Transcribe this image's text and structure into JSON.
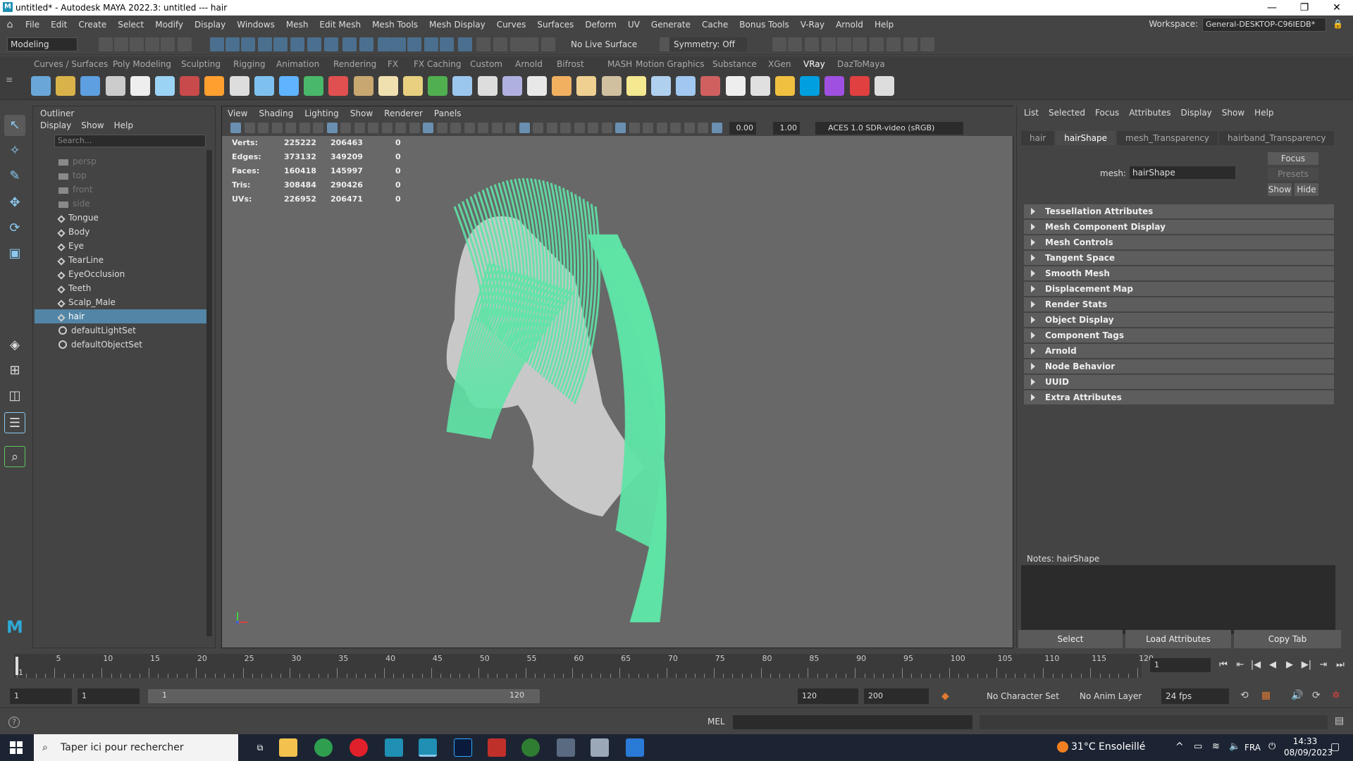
{
  "window": {
    "title": "untitled* - Autodesk MAYA 2022.3: untitled   ---   hair",
    "minimize": "—",
    "restore": "❐",
    "close": "✕"
  },
  "menubar": {
    "items": [
      "File",
      "Edit",
      "Create",
      "Select",
      "Modify",
      "Display",
      "Windows",
      "Mesh",
      "Edit Mesh",
      "Mesh Tools",
      "Mesh Display",
      "Curves",
      "Surfaces",
      "Deform",
      "UV",
      "Generate",
      "Cache",
      "Bonus Tools",
      "V-Ray",
      "Arnold",
      "Help"
    ],
    "workspace_label": "Workspace:",
    "workspace_value": "General-DESKTOP-C96IEDB*"
  },
  "statusline": {
    "mode": "Modeling",
    "live_surface": "No Live Surface",
    "symmetry": "Symmetry: Off"
  },
  "shelf": {
    "tabs": [
      "Curves / Surfaces",
      "Poly Modeling",
      "Sculpting",
      "Rigging",
      "Animation",
      "Rendering",
      "FX",
      "FX Caching",
      "Custom",
      "Arnold",
      "Bifrost",
      "MASH",
      "Motion Graphics",
      "Substance",
      "XGen",
      "VRay",
      "DazToMaya"
    ],
    "active_tab": "VRay",
    "icon_colors": [
      "#6aa7d8",
      "#d9b24a",
      "#5d9fe0",
      "#ccc",
      "#eee",
      "#9bd3f5",
      "#c84a4a",
      "#ff9f30",
      "#ddd",
      "#7ec1f0",
      "#5fb3ff",
      "#4ab86a",
      "#e05050",
      "#c8a870",
      "#f0e0b0",
      "#e8d080",
      "#50b050",
      "#9bc7ef",
      "#ddd",
      "#b0b0e0",
      "#e8e8e8",
      "#f0b060",
      "#f0d090",
      "#d0c0a0",
      "#f4e890",
      "#b0d0f0",
      "#a0c8f0",
      "#d06060",
      "#eee",
      "#e0e0e0",
      "#f0c040",
      "#00a0e0",
      "#a050e0",
      "#e04040",
      "#ddd"
    ]
  },
  "outliner": {
    "title": "Outliner",
    "menu": [
      "Display",
      "Show",
      "Help"
    ],
    "search_placeholder": "Search...",
    "items": [
      {
        "label": "persp",
        "kind": "camera"
      },
      {
        "label": "top",
        "kind": "camera"
      },
      {
        "label": "front",
        "kind": "camera"
      },
      {
        "label": "side",
        "kind": "camera"
      },
      {
        "label": "Tongue",
        "kind": "mesh"
      },
      {
        "label": "Body",
        "kind": "mesh"
      },
      {
        "label": "Eye",
        "kind": "mesh"
      },
      {
        "label": "TearLine",
        "kind": "mesh"
      },
      {
        "label": "EyeOcclusion",
        "kind": "mesh"
      },
      {
        "label": "Teeth",
        "kind": "mesh"
      },
      {
        "label": "Scalp_Male",
        "kind": "mesh"
      },
      {
        "label": "hair",
        "kind": "mesh",
        "selected": true
      },
      {
        "label": "defaultLightSet",
        "kind": "set"
      },
      {
        "label": "defaultObjectSet",
        "kind": "set"
      }
    ]
  },
  "viewport": {
    "menu": [
      "View",
      "Shading",
      "Lighting",
      "Show",
      "Renderer",
      "Panels"
    ],
    "exposure": "0.00",
    "gamma": "1.00",
    "colorspace": "ACES 1.0 SDR-video (sRGB)",
    "hud": [
      {
        "label": "Verts:",
        "a": "225222",
        "b": "206463",
        "c": "0"
      },
      {
        "label": "Edges:",
        "a": "373132",
        "b": "349209",
        "c": "0"
      },
      {
        "label": "Faces:",
        "a": "160418",
        "b": "145997",
        "c": "0"
      },
      {
        "label": "Tris:",
        "a": "308484",
        "b": "290426",
        "c": "0"
      },
      {
        "label": "UVs:",
        "a": "226952",
        "b": "206471",
        "c": "0"
      }
    ],
    "hair_color": "#5fe3a6",
    "skin_color": "#c8c8c8"
  },
  "attribute_editor": {
    "menu": [
      "List",
      "Selected",
      "Focus",
      "Attributes",
      "Display",
      "Show",
      "Help"
    ],
    "tabs": [
      "hair",
      "hairShape",
      "mesh_Transparency",
      "hairband_Transparency"
    ],
    "active_tab": "hairShape",
    "mesh_label": "mesh:",
    "mesh_value": "hairShape",
    "focus": "Focus",
    "presets": "Presets",
    "show": "Show",
    "hide": "Hide",
    "sections": [
      "Tessellation Attributes",
      "Mesh Component Display",
      "Mesh Controls",
      "Tangent Space",
      "Smooth Mesh",
      "Displacement Map",
      "Render Stats",
      "Object Display",
      "Component Tags",
      "Arnold",
      "Node Behavior",
      "UUID",
      "Extra Attributes"
    ],
    "notes_label": "Notes:  hairShape",
    "select": "Select",
    "load_attributes": "Load Attributes",
    "copy_tab": "Copy Tab"
  },
  "timeline": {
    "labels": [
      "1",
      "5",
      "10",
      "15",
      "20",
      "25",
      "30",
      "35",
      "40",
      "45",
      "50",
      "55",
      "60",
      "65",
      "70",
      "75",
      "80",
      "85",
      "90",
      "95",
      "100",
      "105",
      "110",
      "115",
      "120"
    ],
    "current_frame": "1"
  },
  "range": {
    "start": "1",
    "playback_start": "1",
    "slider_start": "1",
    "slider_end": "120",
    "playback_end": "120",
    "end": "200",
    "character_set": "No Character Set",
    "anim_layer": "No Anim Layer",
    "fps": "24 fps"
  },
  "cmdline": {
    "mel": "MEL"
  },
  "taskbar": {
    "search": "Taper ici pour rechercher",
    "weather": "31°C  Ensoleillé",
    "lang": "FRA",
    "time": "14:33",
    "date": "08/09/2023"
  }
}
